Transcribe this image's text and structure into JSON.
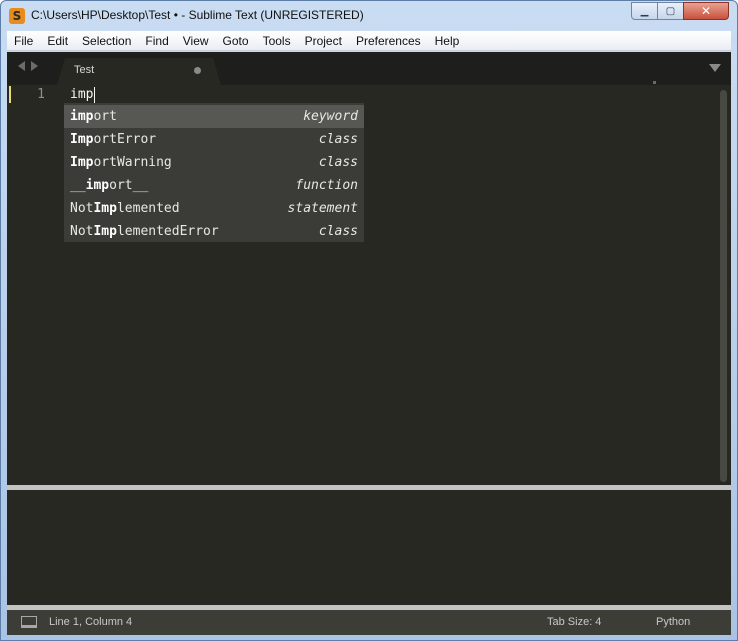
{
  "window": {
    "title": "C:\\Users\\HP\\Desktop\\Test • - Sublime Text (UNREGISTERED)",
    "app_icon_glyph": "S",
    "buttons": {
      "minimize": "▁",
      "maximize": "▢",
      "close": "✕"
    }
  },
  "menu": [
    "File",
    "Edit",
    "Selection",
    "Find",
    "View",
    "Goto",
    "Tools",
    "Project",
    "Preferences",
    "Help"
  ],
  "tabs": [
    {
      "label": "Test",
      "modified": true
    }
  ],
  "editor": {
    "line_number": "1",
    "code": "imp"
  },
  "completions": [
    {
      "pre": "",
      "match": "imp",
      "post": "ort",
      "kind": "keyword",
      "selected": true
    },
    {
      "pre": "",
      "match": "Imp",
      "post": "ortError",
      "kind": "class",
      "selected": false
    },
    {
      "pre": "",
      "match": "Imp",
      "post": "ortWarning",
      "kind": "class",
      "selected": false
    },
    {
      "pre": "__",
      "match": "imp",
      "post": "ort__",
      "kind": "function",
      "selected": false
    },
    {
      "pre": "Not",
      "match": "Imp",
      "post": "lemented",
      "kind": "statement",
      "selected": false
    },
    {
      "pre": "Not",
      "match": "Imp",
      "post": "lementedError",
      "kind": "class",
      "selected": false
    }
  ],
  "status": {
    "position": "Line 1, Column 4",
    "tab_size": "Tab Size: 4",
    "syntax": "Python"
  },
  "colors": {
    "editor_bg": "#272822",
    "tabbar_bg": "#1e1f1c",
    "popup_bg": "#3b3c37",
    "popup_selected": "#575853",
    "statusbar_bg": "#3c3d37"
  }
}
